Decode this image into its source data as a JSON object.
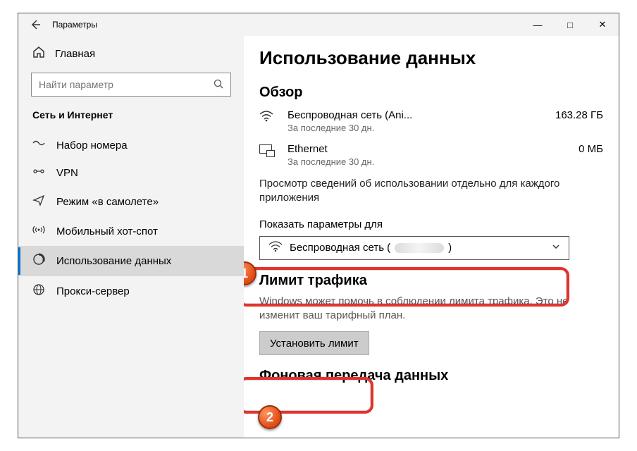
{
  "titlebar": {
    "title": "Параметры"
  },
  "sidebar": {
    "home": "Главная",
    "search_placeholder": "Найти параметр",
    "section": "Сеть и Интернет",
    "items": [
      {
        "label": "Набор номера"
      },
      {
        "label": "VPN"
      },
      {
        "label": "Режим «в самолете»"
      },
      {
        "label": "Мобильный хот-спот"
      },
      {
        "label": "Использование данных"
      },
      {
        "label": "Прокси-сервер"
      }
    ]
  },
  "page": {
    "title": "Использование данных",
    "overview_head": "Обзор",
    "overview": [
      {
        "name": "Беспроводная сеть (Ani...",
        "period": "За последние 30 дн.",
        "value": "163.28 ГБ"
      },
      {
        "name": "Ethernet",
        "period": "За последние 30 дн.",
        "value": "0 МБ"
      }
    ],
    "per_app_desc": "Просмотр сведений об использовании отдельно для каждого приложения",
    "show_for_label": "Показать параметры для",
    "dropdown_prefix": "Беспроводная сеть (",
    "dropdown_suffix": ")",
    "limit_head": "Лимит трафика",
    "limit_desc": "Windows может помочь в соблюдении лимита трафика. Это не изменит ваш тарифный план.",
    "set_limit_btn": "Установить лимит",
    "bg_head": "Фоновая передача данных"
  },
  "callouts": {
    "one": "1",
    "two": "2"
  }
}
